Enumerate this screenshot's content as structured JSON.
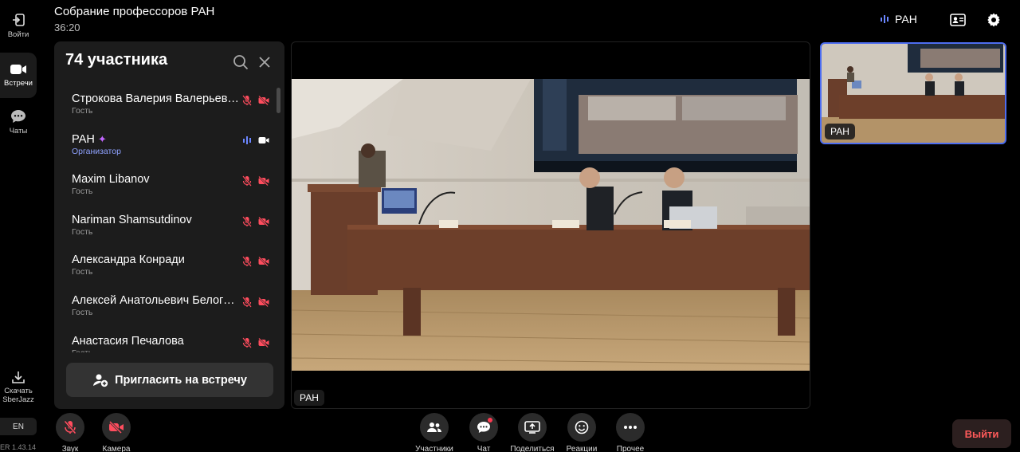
{
  "rail": {
    "login_label": "Войти",
    "meetings_label": "Встречи",
    "chats_label": "Чаты",
    "download_label_1": "Скачать",
    "download_label_2": "SberJazz",
    "lang": "EN",
    "version": "ER 1.43.14"
  },
  "header": {
    "title": "Собрание профессоров РАН",
    "timer": "36:20",
    "active_speaker": "РАН"
  },
  "panel": {
    "title": "74 участника",
    "invite_label": "Пригласить на встречу",
    "participants": [
      {
        "name": "Строкова Валерия Валерьевна",
        "role": "Гость",
        "mic": "off",
        "cam": "off"
      },
      {
        "name": "РАН",
        "role": "Организатор",
        "mic": "on",
        "cam": "on"
      },
      {
        "name": "Maxim Libanov",
        "role": "Гость",
        "mic": "off",
        "cam": "off"
      },
      {
        "name": "Nariman Shamsutdinov",
        "role": "Гость",
        "mic": "off",
        "cam": "off"
      },
      {
        "name": "Александра Конради",
        "role": "Гость",
        "mic": "off",
        "cam": "off"
      },
      {
        "name": "Алексей Анатольевич Белогорцев",
        "role": "Гость",
        "mic": "off",
        "cam": "off"
      },
      {
        "name": "Анастасия Печалова",
        "role": "Гость",
        "mic": "off",
        "cam": "off"
      }
    ]
  },
  "main_video": {
    "label": "РАН"
  },
  "thumbnail": {
    "label": "РАН"
  },
  "toolbar": {
    "sound": "Звук",
    "camera": "Камера",
    "participants": "Участники",
    "chat": "Чат",
    "share": "Поделиться",
    "reactions": "Реакции",
    "more": "Прочее",
    "exit": "Выйти"
  },
  "colors": {
    "accent": "#4d6df0",
    "muted_red": "#ff4d5e",
    "organizer": "#8fa2ff",
    "exit_text": "#ff5a5a"
  }
}
